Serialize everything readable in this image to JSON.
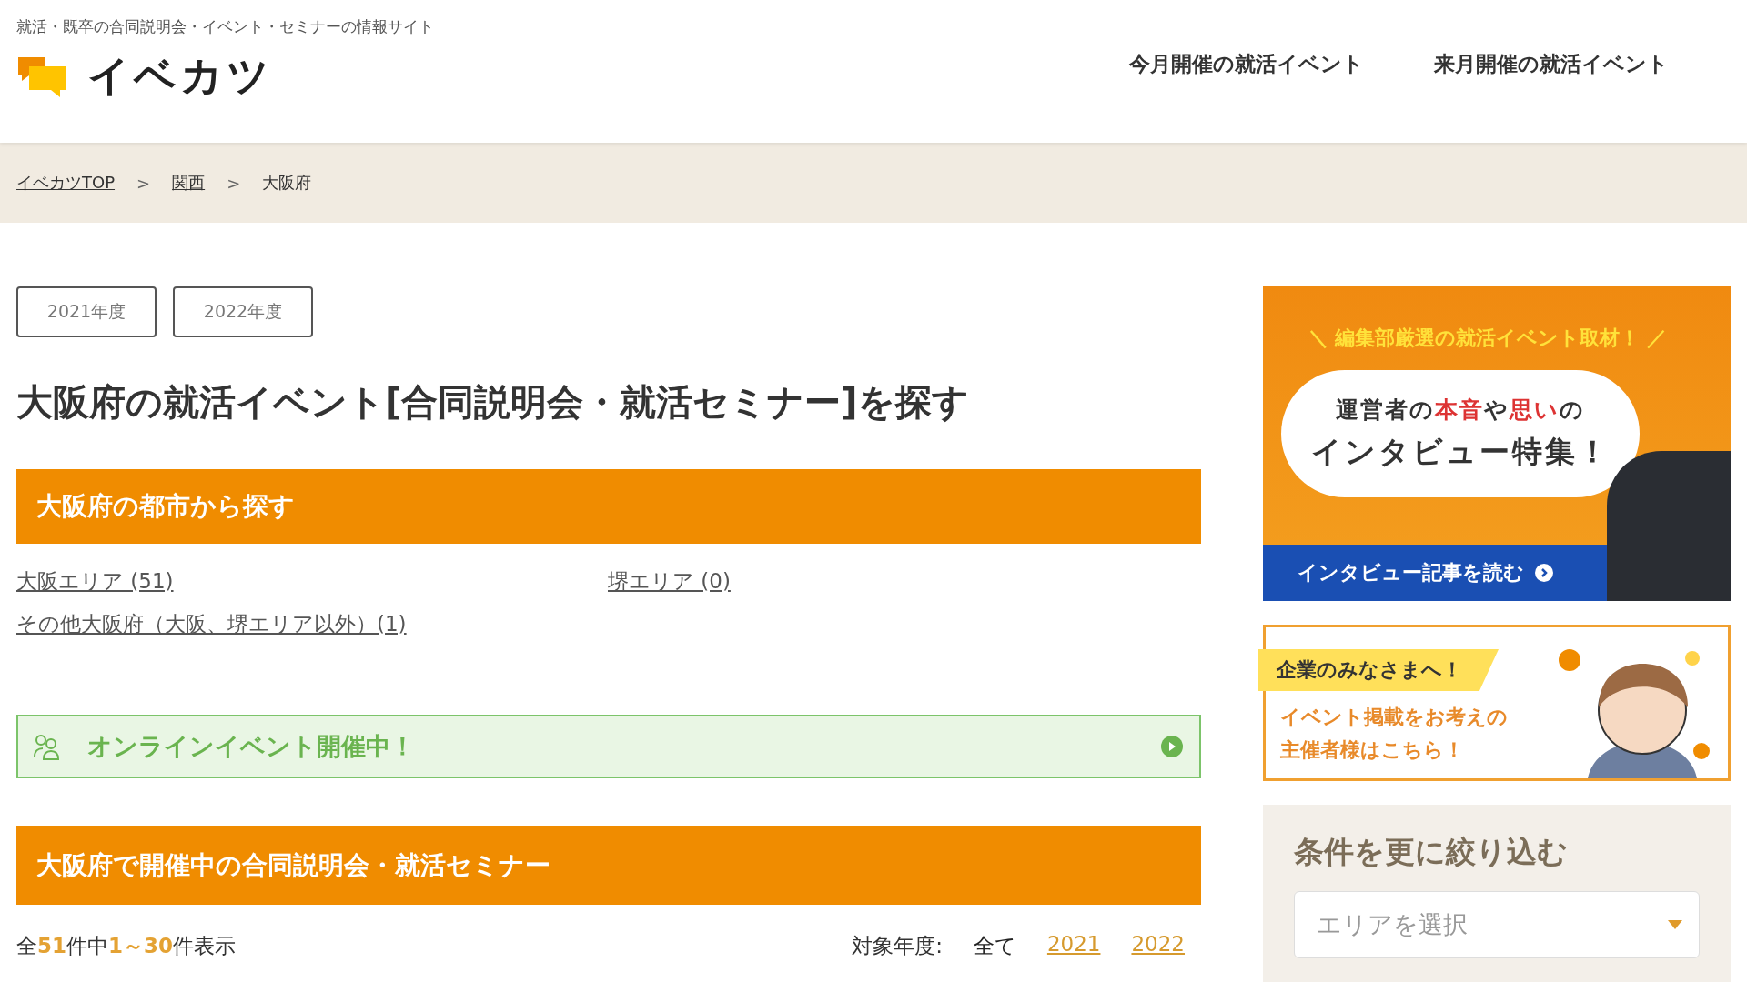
{
  "header": {
    "tagline": "就活・既卒の合同説明会・イベント・セミナーの情報サイト",
    "logo_text": "イベカツ",
    "nav": [
      "今月開催の就活イベント",
      "来月開催の就活イベント"
    ]
  },
  "breadcrumb": [
    {
      "label": "イベカツTOP",
      "link": true
    },
    {
      "label": "関西",
      "link": true
    },
    {
      "label": "大阪府",
      "link": false
    }
  ],
  "breadcrumb_separator": ">",
  "year_buttons": [
    "2021年度",
    "2022年度"
  ],
  "page_title": "大阪府の就活イベント[合同説明会・就活セミナー]を探す",
  "city_section": {
    "heading": "大阪府の都市から探す",
    "links": [
      "大阪エリア (51)",
      "堺エリア (0)",
      "その他大阪府（大阪、堺エリア以外）(1)"
    ]
  },
  "online_banner": {
    "label": "オンラインイベント開催中！"
  },
  "event_section": {
    "heading": "大阪府で開催中の合同説明会・就活セミナー"
  },
  "count": [
    {
      "text": "全",
      "highlight": false
    },
    {
      "text": "51",
      "highlight": true
    },
    {
      "text": "件中",
      "highlight": false
    },
    {
      "text": "1～30",
      "highlight": true
    },
    {
      "text": "件表示",
      "highlight": false
    }
  ],
  "year_filter": {
    "label": "対象年度:",
    "options": [
      {
        "label": "全て",
        "selected": true
      },
      {
        "label": "2021",
        "selected": false
      },
      {
        "label": "2022",
        "selected": false
      }
    ]
  },
  "interview_banner": {
    "headline": "＼ 編集部厳選の就活イベント取材！ ／",
    "subline": [
      {
        "text": "運営者の",
        "emphasis": false
      },
      {
        "text": "本音",
        "emphasis": true
      },
      {
        "text": "や",
        "emphasis": false
      },
      {
        "text": "思い",
        "emphasis": true
      },
      {
        "text": "の",
        "emphasis": false
      }
    ],
    "title": "インタビュー特集！",
    "button": "インタビュー記事を読む"
  },
  "company_banner": {
    "tag": "企業のみなさまへ！",
    "lines": [
      "イベント掲載をお考えの",
      "主催者様はこちら！"
    ]
  },
  "filter": {
    "heading": "条件を更に絞り込む",
    "select_placeholder": "エリアを選択"
  }
}
